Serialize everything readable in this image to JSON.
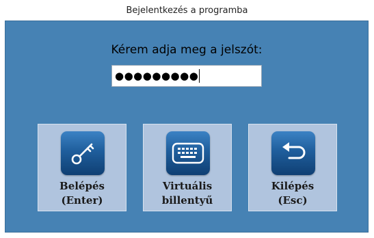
{
  "window": {
    "title": "Bejelentkezés a programba"
  },
  "login": {
    "prompt": "Kérem adja meg a jelszót:",
    "password_mask": "●●●●●●●●●"
  },
  "buttons": {
    "login": {
      "label": "Belépés\n(Enter)",
      "icon": "key-icon"
    },
    "keyboard": {
      "label": "Virtuális\nbillentyű",
      "icon": "keyboard-icon"
    },
    "exit": {
      "label": "Kilépés\n(Esc)",
      "icon": "return-arrow-icon"
    }
  },
  "colors": {
    "panel": "#4682b4",
    "tile": "#b0c4de",
    "icon_gradient_top": "#3c82c4",
    "icon_gradient_bottom": "#0f3f73"
  }
}
